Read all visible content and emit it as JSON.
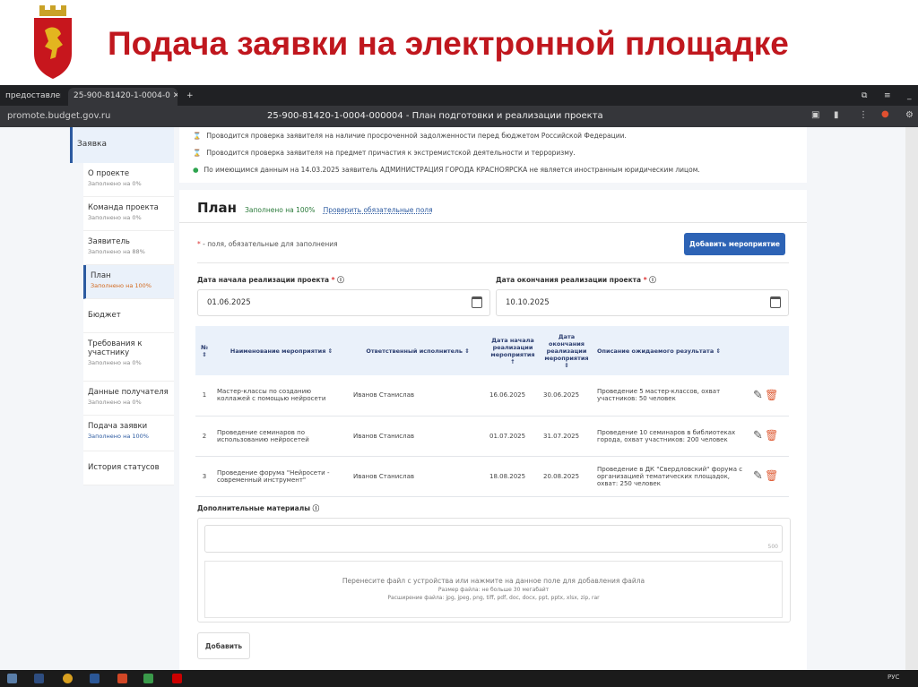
{
  "slide": {
    "title": "Подача заявки на электронной площадке"
  },
  "browser": {
    "tab_prev": "предоставления",
    "tab_active": "25-900-81420-1-0004-0",
    "url": "promote.budget.gov.ru",
    "page_title": "25-900-81420-1-0004-000004 - План подготовки и реализации проекта"
  },
  "checks": [
    {
      "icon": "hourglass-icon",
      "text": "Проводится проверка заявителя на наличие просроченной задолженности перед бюджетом Российской Федерации."
    },
    {
      "icon": "hourglass-icon",
      "text": "Проводится проверка заявителя на предмет причастия к экстремистской деятельности и терроризму."
    },
    {
      "icon": "check-circle-icon",
      "text": "По имеющимся данным на 14.03.2025 заявитель АДМИНИСТРАЦИЯ ГОРОДА КРАСНОЯРСКА не является иностранным юридическим лицом."
    }
  ],
  "sidebar": {
    "top": "Заявка",
    "items": [
      {
        "label": "О проекте",
        "sub": "Заполнено на 0%"
      },
      {
        "label": "Команда проекта",
        "sub": "Заполнено на 0%"
      },
      {
        "label": "Заявитель",
        "sub": "Заполнено на 88%"
      },
      {
        "label": "План",
        "sub": "Заполнено на 100%"
      },
      {
        "label": "Бюджет",
        "sub": ""
      },
      {
        "label": "Требования к участнику",
        "sub": "Заполнено на 0%"
      },
      {
        "label": "Данные получателя",
        "sub": "Заполнено на 0%"
      },
      {
        "label": "Подача заявки",
        "sub": "Заполнено на 100%"
      },
      {
        "label": "История статусов",
        "sub": ""
      }
    ]
  },
  "plan": {
    "title": "План",
    "filled": "Заполнено на 100%",
    "check_link": "Проверить обязательные поля",
    "required_note": "- поля, обязательные для заполнения",
    "add_event_button": "Добавить мероприятие",
    "start_label": "Дата начала реализации проекта",
    "start_value": "01.06.2025",
    "end_label": "Дата окончания реализации проекта",
    "end_value": "10.10.2025"
  },
  "table": {
    "headers": [
      "№",
      "Наименование мероприятия",
      "Ответственный исполнитель",
      "Дата начала реализации мероприятия",
      "Дата окончания реализации мероприятия",
      "Описание ожидаемого результата"
    ],
    "rows": [
      [
        "1",
        "Мастер-классы по созданию коллажей с помощью нейросети",
        "Иванов Станислав",
        "16.06.2025",
        "30.06.2025",
        "Проведение 5 мастер-классов, охват участников: 50 человек"
      ],
      [
        "2",
        "Проведение семинаров по использованию нейросетей",
        "Иванов Станислав",
        "01.07.2025",
        "31.07.2025",
        "Проведение 10 семинаров в библиотеках города, охват участников: 200 человек"
      ],
      [
        "3",
        "Проведение форума \"Нейросети - современный инструмент\"",
        "Иванов Станислав",
        "18.08.2025",
        "20.08.2025",
        "Проведение в ДК \"Свердловский\" форума с организацией тематических площадок, охват: 250 человек"
      ]
    ]
  },
  "materials": {
    "label": "Дополнительные материалы",
    "counter": "500",
    "drop_main": "Перенесите файл с устройства или нажмите на данное поле для добавления файла",
    "drop_size": "Размер файла: не больше 30 мегабайт",
    "drop_ext": "Расширение файла: jpg, jpeg, png, tiff, pdf, doc, docx, ppt, pptx, xlsx, zip, rar",
    "add_button": "Добавить"
  },
  "taskbar": {
    "lang": "РУС"
  }
}
